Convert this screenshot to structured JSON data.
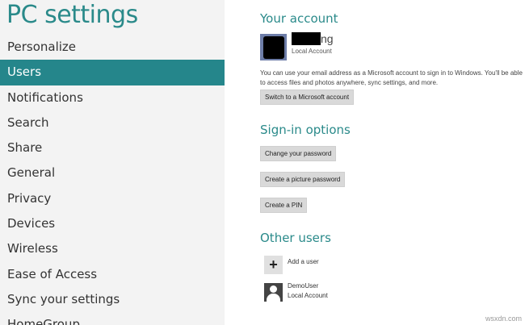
{
  "sidebar": {
    "title": "PC settings",
    "items": [
      {
        "label": "Personalize"
      },
      {
        "label": "Users"
      },
      {
        "label": "Notifications"
      },
      {
        "label": "Search"
      },
      {
        "label": "Share"
      },
      {
        "label": "General"
      },
      {
        "label": "Privacy"
      },
      {
        "label": "Devices"
      },
      {
        "label": "Wireless"
      },
      {
        "label": "Ease of Access"
      },
      {
        "label": "Sync your settings"
      },
      {
        "label": "HomeGroup"
      }
    ],
    "selected": "Users"
  },
  "account": {
    "title": "Your account",
    "name_visible": "ng",
    "type": "Local Account",
    "description": "You can use your email address as a Microsoft account to sign in to Windows. You'll be able to access files and photos anywhere, sync settings, and more.",
    "switch_button": "Switch to a Microsoft account"
  },
  "signin": {
    "title": "Sign-in options",
    "change_password": "Change your password",
    "picture_password": "Create a picture password",
    "pin": "Create a PIN"
  },
  "other_users": {
    "title": "Other users",
    "add_user": "Add a user",
    "users": [
      {
        "name": "DemoUser",
        "type": "Local Account"
      }
    ]
  },
  "watermark": "wsxdn.com",
  "colors": {
    "accent": "#25868b",
    "sidebar_bg": "#f3f3f3",
    "button_bg": "#d9d9d9"
  }
}
